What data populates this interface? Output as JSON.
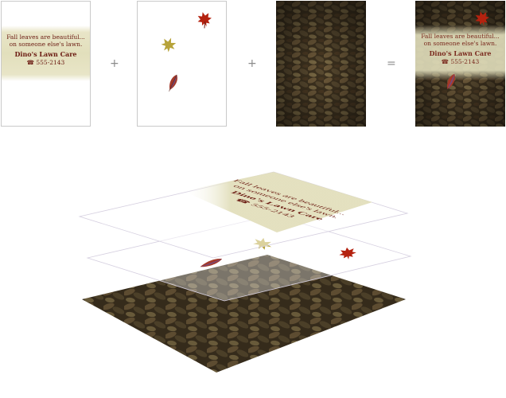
{
  "card": {
    "line1": "Fall leaves are beautiful...",
    "line2": "on someone else's lawn.",
    "business": "Dino's Lawn Care",
    "phone_icon": "☎",
    "phone": "555-2143"
  },
  "operators": {
    "plus": "+",
    "equals": "="
  },
  "icons": {
    "leaf_red": "maple-leaf-red",
    "leaf_yellow": "maple-leaf-yellow",
    "leaf_feather": "feather-leaf"
  },
  "colors": {
    "text": "#6b1b12",
    "band": "#e2dfbc",
    "leaf_red": "#b4220f",
    "leaf_yellow": "#b7a33a",
    "ground": "#4a3b22"
  }
}
